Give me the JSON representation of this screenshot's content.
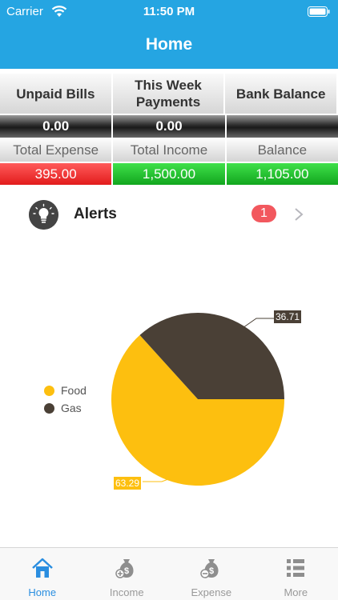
{
  "status_bar": {
    "carrier": "Carrier",
    "time": "11:50 PM"
  },
  "header": {
    "title": "Home"
  },
  "summary": {
    "headings": [
      "Unpaid Bills",
      "This Week Payments",
      "Bank Balance"
    ],
    "dark_values": [
      "0.00",
      "0.00",
      ""
    ],
    "sub_headings": [
      "Total Expense",
      "Total Income",
      "Balance"
    ],
    "values": [
      "395.00",
      "1,500.00",
      "1,105.00"
    ]
  },
  "alerts": {
    "label": "Alerts",
    "count": "1"
  },
  "chart_data": {
    "type": "pie",
    "categories": [
      "Food",
      "Gas"
    ],
    "values": [
      63.29,
      36.71
    ],
    "colors": [
      "#fdbf0f",
      "#4a4036"
    ],
    "value_labels": [
      "63.29",
      "36.71"
    ],
    "legend_position": "left"
  },
  "tabbar": {
    "items": [
      {
        "label": "Home",
        "icon": "home-icon",
        "active": true
      },
      {
        "label": "Income",
        "icon": "money-bag-plus-icon",
        "active": false
      },
      {
        "label": "Expense",
        "icon": "money-bag-minus-icon",
        "active": false
      },
      {
        "label": "More",
        "icon": "list-icon",
        "active": false
      }
    ]
  },
  "colors": {
    "accent": "#25a5e2",
    "tab_active": "#2a8ee0",
    "expense_red": "#e21c1c",
    "income_green": "#12a61e",
    "badge": "#f2585e"
  }
}
